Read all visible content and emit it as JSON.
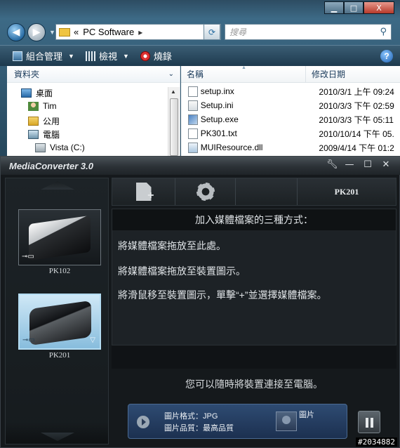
{
  "explorer": {
    "window_controls": {
      "minimize": "▁",
      "maximize": "□",
      "close": "X"
    },
    "address": {
      "prefix": "«",
      "folder": "PC Software",
      "separator": "▸"
    },
    "search_placeholder": "搜尋",
    "commands": [
      {
        "label": "組合管理",
        "icon": "organize-icon"
      },
      {
        "label": "檢視",
        "icon": "views-icon"
      },
      {
        "label": "燒錄",
        "icon": "burn-icon"
      }
    ],
    "nav": {
      "header": "資料夾",
      "items": [
        {
          "label": "桌面",
          "icon": "desktop-icon"
        },
        {
          "label": "Tim",
          "icon": "user-folder-icon"
        },
        {
          "label": "公用",
          "icon": "public-folder-icon"
        },
        {
          "label": "電腦",
          "icon": "computer-icon"
        },
        {
          "label": "Vista (C:)",
          "icon": "drive-icon"
        }
      ]
    },
    "columns": {
      "name": "名稱",
      "date": "修改日期"
    },
    "files": [
      {
        "name": "setup.inx",
        "date": "2010/3/1 上午 09:24",
        "type": "inx"
      },
      {
        "name": "Setup.ini",
        "date": "2010/3/3 下午 02:59",
        "type": "ini"
      },
      {
        "name": "Setup.exe",
        "date": "2010/3/3 下午 05:11",
        "type": "exe"
      },
      {
        "name": "PK301.txt",
        "date": "2010/10/14 下午 05.",
        "type": "txt"
      },
      {
        "name": "MUIResource.dll",
        "date": "2009/4/14 下午 01:2",
        "type": "dll"
      }
    ]
  },
  "mediaconverter": {
    "title": "MediaConverter 3.0",
    "devices": [
      {
        "label": "PK102",
        "selected": false
      },
      {
        "label": "PK201",
        "selected": true
      }
    ],
    "toolbar": {
      "current_device": "PK201"
    },
    "instructions": {
      "heading": "加入媒體檔案的三種方式：",
      "lines": [
        "將媒體檔案拖放至此處。",
        "將媒體檔案拖放至裝置圖示。",
        "將滑鼠移至裝置圖示，單擊“+”並選擇媒體檔案。"
      ]
    },
    "connect_message": "您可以隨時將裝置連接至電腦。",
    "player": {
      "format_line": "圖片格式：JPG",
      "quality_line": "圖片品質：最高品質",
      "thumb_label": "圖片"
    }
  },
  "watermark": "#2034882"
}
